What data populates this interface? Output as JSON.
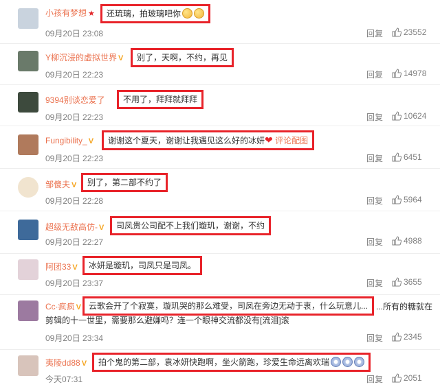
{
  "comments": [
    {
      "user": "小孩有梦想",
      "badge": "★",
      "text": "还琉璃，拍玻璃吧你",
      "emojis": 2,
      "time": "09月20日 23:08",
      "reply": "回复",
      "likes": "23552",
      "avatar_color": "#c9d3de"
    },
    {
      "user": "Y柳沉浸的虚拟世界",
      "badge": "V",
      "text": "别了，天啊，不约，再见",
      "time": "09月20日 22:23",
      "reply": "回复",
      "likes": "14978",
      "avatar_color": "#6a7a6a"
    },
    {
      "user": "9394别谈恋爱了",
      "text": "不用了，拜拜就拜拜",
      "time": "09月20日 22:23",
      "reply": "回复",
      "likes": "10624",
      "avatar_color": "#3d4a3d"
    },
    {
      "user": "Fungibility_",
      "badge": "V",
      "text": "谢谢这个夏天，谢谢让我遇见这么好的冰妍",
      "link": "评论配图",
      "time": "09月20日 22:23",
      "reply": "回复",
      "likes": "6451",
      "avatar_color": "#b07a5c"
    },
    {
      "user": "邹傻夫",
      "badge": "V",
      "text": "别了，第二部不约了",
      "time": "09月20日 22:28",
      "reply": "回复",
      "likes": "5964",
      "avatar_color": "#f1e4cf"
    },
    {
      "user": "超级无敌高仿-",
      "badge": "V",
      "text": "司凤贵公司配不上我们璇玑，谢谢，不约",
      "time": "09月20日 22:27",
      "reply": "回复",
      "likes": "4988",
      "avatar_color": "#3e6a9a"
    },
    {
      "user": "阿团33",
      "badge": "V",
      "text": "冰妍是璇玑，司凤只是司凤。",
      "time": "09月20日 23:37",
      "reply": "回复",
      "likes": "3655",
      "avatar_color": "#e3d2d9"
    },
    {
      "user": "Cc·疯疯",
      "badge": "V",
      "text": "云歌会开了个寂寞，璇玑哭的那么难受，司凤在旁边无动于衷，什么玩意儿...",
      "text_cont": "...所有的糖就在",
      "text_line2": "剪辑的十一世里，需要那么避嫌吗？连一个眼神交流都没有[流泪]滚",
      "time": "09月20日 23:34",
      "reply": "回复",
      "likes": "2345",
      "avatar_color": "#9c7aa0"
    },
    {
      "user": "夷陵dd88",
      "badge": "V",
      "text": "拍个鬼的第二部，袁冰妍快跑啊，坐火箭跑，珍爱生命远离欢瑞",
      "emojis": 3,
      "time": "今天07:31",
      "reply": "回复",
      "likes": "2051",
      "avatar_color": "#d8c4bb"
    }
  ]
}
